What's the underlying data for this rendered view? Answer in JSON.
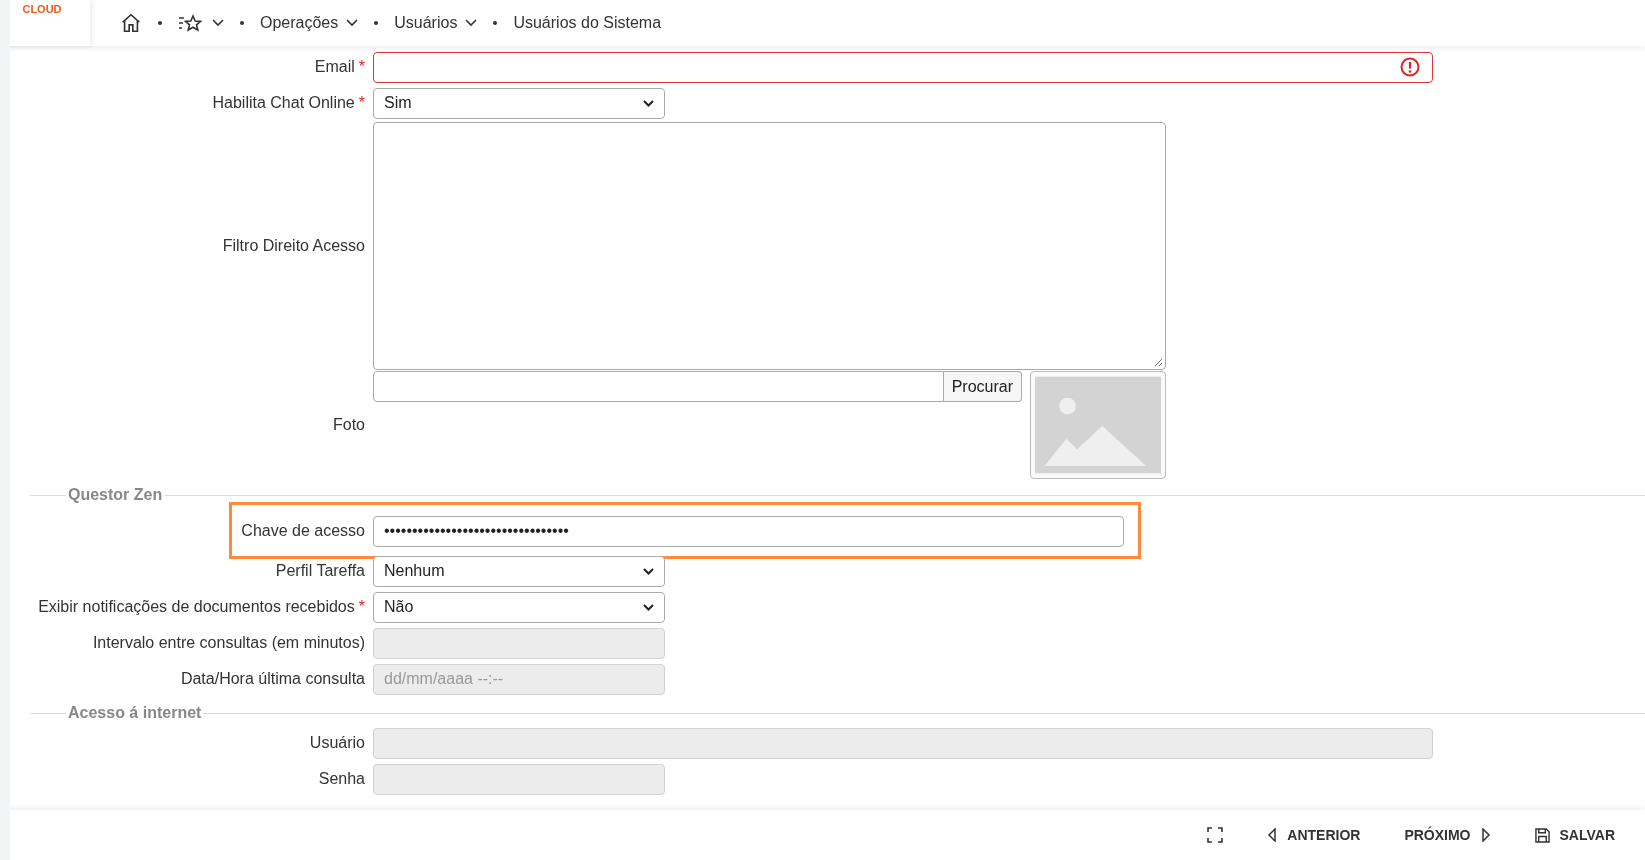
{
  "logo": {
    "text": "CLOUD"
  },
  "breadcrumb": [
    {
      "label": "Operações",
      "kind": "menu"
    },
    {
      "label": "Usuários",
      "kind": "menu"
    },
    {
      "label": "Usuários do Sistema",
      "kind": "page"
    }
  ],
  "sections": [
    {
      "fields": [
        {
          "label": "Email",
          "mark": "*",
          "kind": "text",
          "invalid": true,
          "disabled": false
        },
        {
          "label": "Habilita Chat Online",
          "mark": "*",
          "kind": "select",
          "value": "Sim",
          "disabled": false
        },
        {
          "label": "Filtro Direito Acesso",
          "kind": "textarea",
          "disabled": false
        },
        {
          "label": "Foto",
          "kind": "file",
          "button": "Procurar",
          "disabled": false
        }
      ]
    },
    {
      "legend": "Questor Zen",
      "fields": [
        {
          "label": "Chave de acesso",
          "kind": "text",
          "value": "•••••••••••••••••••••••••••••••••",
          "highlighted": true,
          "disabled": false
        },
        {
          "label": "Perfil Tareffa",
          "kind": "select",
          "value": "Nenhum",
          "disabled": false
        },
        {
          "label": "Exibir notificações de documentos recebidos",
          "mark": "*",
          "kind": "select",
          "value": "Não",
          "disabled": false
        },
        {
          "label": "Intervalo entre consultas (em minutos)",
          "kind": "text",
          "disabled": true
        },
        {
          "label": "Data/Hora última consulta",
          "kind": "text",
          "placeholder": "dd/mm/aaaa --:--",
          "disabled": true
        }
      ]
    },
    {
      "legend": "Acesso á internet",
      "fields": [
        {
          "label": "Usuário",
          "kind": "text",
          "disabled": true
        },
        {
          "label": "Senha",
          "kind": "text",
          "disabled": true
        }
      ]
    }
  ],
  "footer": {
    "buttons": [
      {
        "kind": "expand"
      },
      {
        "kind": "prev",
        "label": "ANTERIOR"
      },
      {
        "kind": "next",
        "label": "PRÓXIMO"
      },
      {
        "kind": "save",
        "label": "SALVAR"
      }
    ]
  }
}
